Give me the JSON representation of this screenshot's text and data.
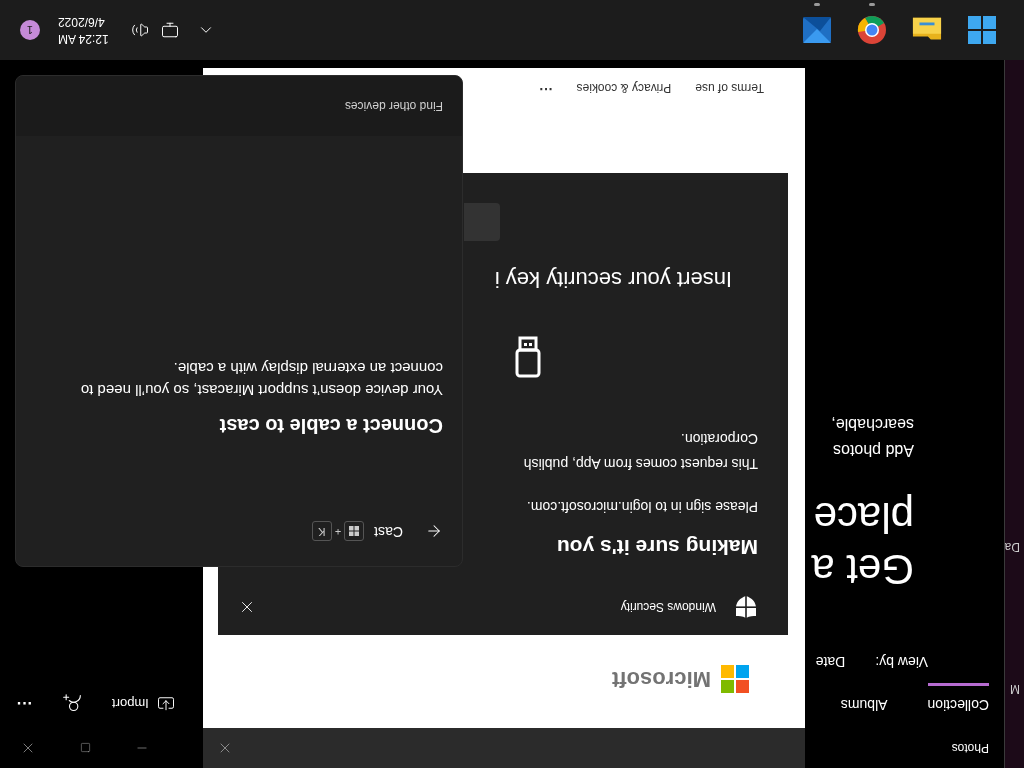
{
  "background_window": {
    "texts": [
      "M",
      "Da"
    ]
  },
  "photos": {
    "title": "Photos",
    "tabs": [
      {
        "label": "Collection",
        "selected": true
      },
      {
        "label": "Albums",
        "selected": false
      }
    ],
    "toolbar": {
      "import": "Import",
      "more": "···"
    },
    "view_by": {
      "label": "View by:",
      "value": "Date"
    },
    "hero_title_lines": [
      "Get a",
      "place"
    ],
    "hero_text_lines": [
      "Add photos",
      "searchable,"
    ]
  },
  "browser": {
    "brand": "Microsoft",
    "footer_links": [
      "Terms of use",
      "Privacy & cookies"
    ],
    "more": "···"
  },
  "security_dialog": {
    "app": "Windows Security",
    "title": "Making sure it's you",
    "lines": [
      "Please sign in to login.microsoft.com.",
      "This request comes from App, publish",
      "Corporation."
    ],
    "prompt": "Insert your security key i"
  },
  "cast": {
    "back_label": "Cast",
    "keys": [
      {
        "kind": "windows"
      },
      {
        "kind": "letter",
        "label": "K"
      }
    ],
    "joiner": "+",
    "title": "Connect a cable to cast",
    "body": "Your device doesn’t support Miracast, so you’ll need to connect an external display with a cable.",
    "footer": "Find other devices"
  },
  "taskbar": {
    "apps": [
      {
        "kind": "start",
        "running": false
      },
      {
        "kind": "explorer",
        "running": false
      },
      {
        "kind": "chrome",
        "running": true
      },
      {
        "kind": "mail",
        "running": true
      }
    ],
    "time": "12:24 AM",
    "date": "4/6/2022",
    "notifications": "1"
  }
}
